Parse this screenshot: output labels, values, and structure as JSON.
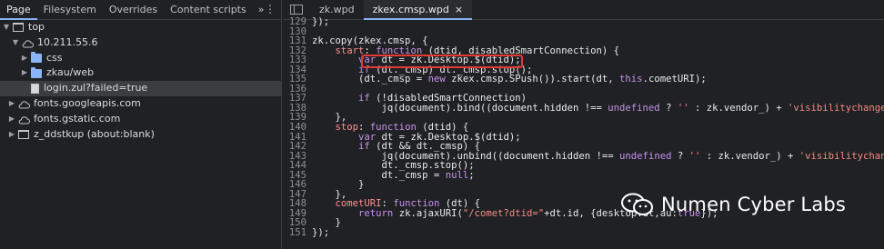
{
  "left_panel": {
    "tabs": [
      "Page",
      "Filesystem",
      "Overrides",
      "Content scripts"
    ],
    "more": "»",
    "menu_icon": "kebab-menu-icon",
    "tree": [
      {
        "label": "top",
        "icon": "frame-icon",
        "expanded": true,
        "indent": 0
      },
      {
        "label": "10.211.55.6",
        "icon": "cloud-icon",
        "expanded": true,
        "indent": 1
      },
      {
        "label": "css",
        "icon": "folder-icon",
        "expanded": false,
        "indent": 2
      },
      {
        "label": "zkau/web",
        "icon": "folder-icon",
        "expanded": false,
        "indent": 2
      },
      {
        "label": "login.zul?failed=true",
        "icon": "file-icon",
        "selected": true,
        "indent": 2
      },
      {
        "label": "fonts.googleapis.com",
        "icon": "cloud-icon",
        "expanded": false,
        "indent": 0
      },
      {
        "label": "fonts.gstatic.com",
        "icon": "cloud-icon",
        "expanded": false,
        "indent": 0
      },
      {
        "label": "z_ddstkup (about:blank)",
        "icon": "frame-icon",
        "expanded": false,
        "indent": 0
      }
    ]
  },
  "editor": {
    "tabs": [
      {
        "label": "zk.wpd",
        "active": false
      },
      {
        "label": "zkex.cmsp.wpd",
        "active": true,
        "close": "×"
      }
    ],
    "lines": [
      {
        "n": "129",
        "t": "});"
      },
      {
        "n": "130",
        "t": ""
      },
      {
        "n": "131",
        "t": "zk.copy(zkex.cmsp, {"
      },
      {
        "n": "132",
        "t": "    start: function (dtid, disabledSmartConnection) {"
      },
      {
        "n": "133",
        "t": "        var dt = zk.Desktop.$(dtid);"
      },
      {
        "n": "134",
        "t": "        if (dt._cmsp) dt._cmsp.stop();"
      },
      {
        "n": "135",
        "t": "        (dt._cmsp = new zkex.cmsp.SPush()).start(dt, this.cometURI);"
      },
      {
        "n": "136",
        "t": ""
      },
      {
        "n": "137",
        "t": "        if (!disabledSmartConnection)"
      },
      {
        "n": "138",
        "t": "            jq(document).bind((document.hidden !== undefined ? '' : zk.vendor_) + 'visibilitychange', dt"
      },
      {
        "n": "139",
        "t": "    },"
      },
      {
        "n": "140",
        "t": "    stop: function (dtid) {"
      },
      {
        "n": "141",
        "t": "        var dt = zk.Desktop.$(dtid);"
      },
      {
        "n": "142",
        "t": "        if (dt && dt._cmsp) {"
      },
      {
        "n": "143",
        "t": "            jq(document).unbind((document.hidden !== undefined ? '' : zk.vendor_) + 'visibilitychange',"
      },
      {
        "n": "144",
        "t": "            dt._cmsp.stop();"
      },
      {
        "n": "145",
        "t": "            dt._cmsp = null;"
      },
      {
        "n": "146",
        "t": "        }"
      },
      {
        "n": "147",
        "t": "    },"
      },
      {
        "n": "148",
        "t": "    cometURI: function (dt) {"
      },
      {
        "n": "149",
        "t": "        return zk.ajaxURI(\"/comet?dtid=\"+dt.id, {desktop:dt,au:true});"
      },
      {
        "n": "150",
        "t": "    }"
      },
      {
        "n": "151",
        "t": "});"
      }
    ]
  },
  "watermark": {
    "text": "Numen Cyber Labs",
    "icon": "wechat-icon"
  },
  "colors": {
    "background": "#202124",
    "highlight_box": "#e53935",
    "accent": "#8ab4f8"
  }
}
